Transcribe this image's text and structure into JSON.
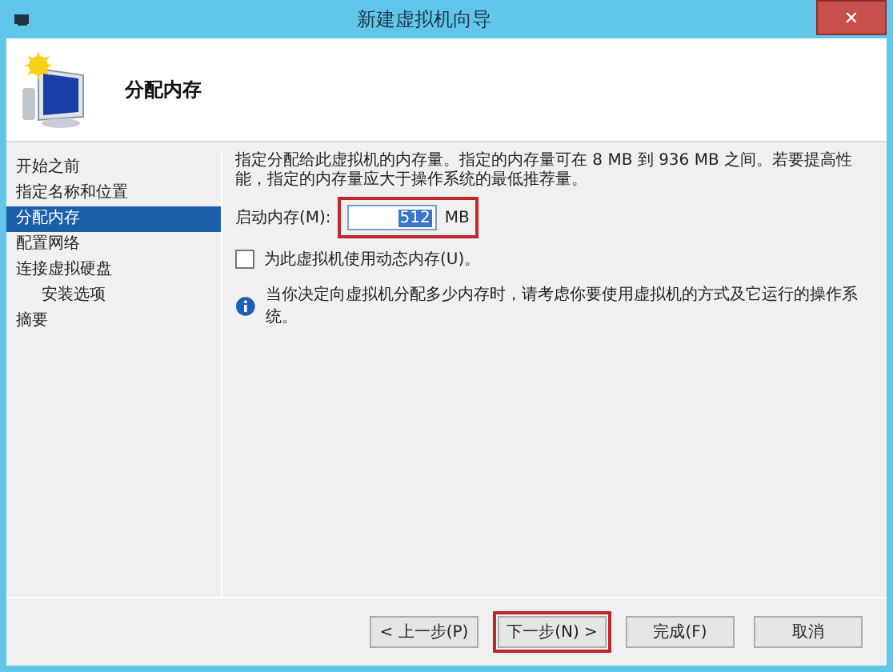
{
  "window": {
    "title": "新建虚拟机向导",
    "close": "✕"
  },
  "header": {
    "title": "分配内存"
  },
  "steps": [
    {
      "label": "开始之前",
      "selected": false
    },
    {
      "label": "指定名称和位置",
      "selected": false
    },
    {
      "label": "分配内存",
      "selected": true
    },
    {
      "label": "配置网络",
      "selected": false
    },
    {
      "label": "连接虚拟硬盘",
      "selected": false,
      "children": [
        {
          "label": "安装选项",
          "selected": false
        }
      ]
    },
    {
      "label": "摘要",
      "selected": false
    }
  ],
  "description": "指定分配给此虚拟机的内存量。指定的内存量可在 8 MB 到 936 MB 之间。若要提高性能，指定的内存量应大于操作系统的最低推荐量。",
  "memory": {
    "label": "启动内存(M):",
    "value": "512",
    "unit": "MB",
    "highlighted": true
  },
  "dynamic_memory": {
    "label": "为此虚拟机使用动态内存(U)。",
    "checked": false
  },
  "info": "当你决定向虚拟机分配多少内存时，请考虑你要使用虚拟机的方式及它运行的操作系统。",
  "buttons": [
    {
      "label": "< 上一步(P)",
      "highlighted": false
    },
    {
      "label": "下一步(N) >",
      "highlighted": true
    },
    {
      "label": "完成(F)",
      "highlighted": false
    },
    {
      "label": "取消",
      "highlighted": false
    }
  ]
}
